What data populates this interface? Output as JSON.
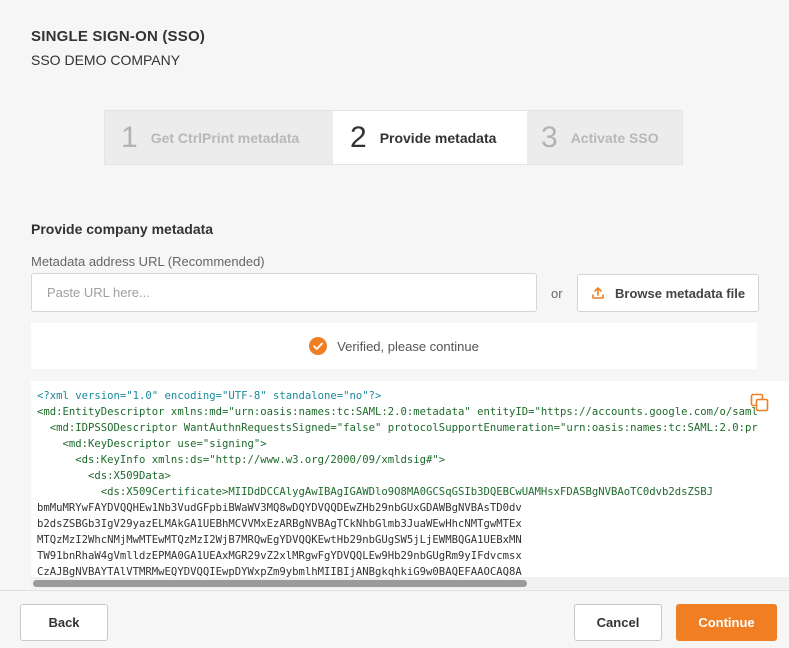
{
  "header": {
    "title": "SINGLE SIGN-ON (SSO)",
    "subtitle": "SSO DEMO COMPANY"
  },
  "stepper": {
    "steps": [
      {
        "number": "1",
        "label": "Get CtrlPrint metadata",
        "state": "inactive"
      },
      {
        "number": "2",
        "label": "Provide metadata",
        "state": "active"
      },
      {
        "number": "3",
        "label": "Activate SSO",
        "state": "inactive"
      }
    ]
  },
  "form": {
    "section_title": "Provide company metadata",
    "url_label": "Metadata address URL (Recommended)",
    "url_placeholder": "Paste URL here...",
    "url_value": "",
    "or_text": "or",
    "browse_label": "Browse metadata file",
    "browse_icon": "upload-icon"
  },
  "status": {
    "text": "Verified, please continue",
    "icon": "check-circle-icon",
    "color": "#f07f23"
  },
  "metadata_xml": {
    "lines": [
      "<?xml version=\"1.0\" encoding=\"UTF-8\" standalone=\"no\"?>",
      "<md:EntityDescriptor xmlns:md=\"urn:oasis:names:tc:SAML:2.0:metadata\" entityID=\"https://accounts.google.com/o/saml",
      "  <md:IDPSSODescriptor WantAuthnRequestsSigned=\"false\" protocolSupportEnumeration=\"urn:oasis:names:tc:SAML:2.0:pr",
      "    <md:KeyDescriptor use=\"signing\">",
      "      <ds:KeyInfo xmlns:ds=\"http://www.w3.org/2000/09/xmldsig#\">",
      "        <ds:X509Data>",
      "          <ds:X509Certificate>MIIDdDCCAlygAwIBAgIGAWDlo9O8MA0GCSqGSIb3DQEBCwUAMHsxFDASBgNVBAoTC0dvb2dsZSBJ",
      "bmMuMRYwFAYDVQQHEw1Nb3VudGFpbiBWaWV3MQ8wDQYDVQQDEwZHb29nbGUxGDAWBgNVBAsTD0dv",
      "b2dsZSBGb3IgV29yazELMAkGA1UEBhMCVVMxEzARBgNVBAgTCkNhbGlmb3JuaWEwHhcNMTgwMTEx",
      "MTQzMzI2WhcNMjMwMTEwMTQzMzI2WjB7MRQwEgYDVQQKEwtHb29nbGUgSW5jLjEWMBQGA1UEBxMN",
      "TW91bnRhaW4gVmlldzEPMA0GA1UEAxMGR29vZ2xlMRgwFgYDVQQLEw9Hb29nbGUgRm9yIFdvcmsx",
      "CzAJBgNVBAYTAlVTMRMwEQYDVQQIEwpDYWxpZm9ybmlhMIIBIjANBgkqhkiG9w0BAQEFAAOCAQ8A"
    ],
    "copy_icon": "copy-icon"
  },
  "footer": {
    "back_label": "Back",
    "cancel_label": "Cancel",
    "continue_label": "Continue",
    "accent_color": "#f07f23"
  }
}
